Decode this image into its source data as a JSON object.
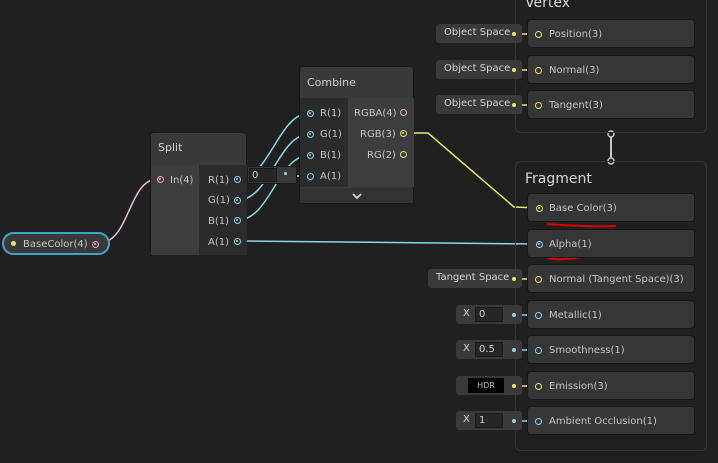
{
  "graph": {
    "property_node": {
      "label": "BaseColor(4)"
    },
    "split_node": {
      "title": "Split",
      "input": "In(4)",
      "outputs": [
        "R(1)",
        "G(1)",
        "B(1)",
        "A(1)"
      ]
    },
    "combine_node": {
      "title": "Combine",
      "inputs": [
        "R(1)",
        "G(1)",
        "B(1)",
        "A(1)"
      ],
      "outputs": [
        "RGBA(4)",
        "RGB(3)",
        "RG(2)"
      ],
      "a_default": "0"
    },
    "vertex": {
      "title": "Vertex",
      "blocks": [
        {
          "label": "Position(3)",
          "input": "Object Space"
        },
        {
          "label": "Normal(3)",
          "input": "Object Space"
        },
        {
          "label": "Tangent(3)",
          "input": "Object Space"
        }
      ]
    },
    "fragment": {
      "title": "Fragment",
      "blocks": [
        {
          "label": "Base Color(3)"
        },
        {
          "label": "Alpha(1)"
        },
        {
          "label": "Normal (Tangent Space)(3)",
          "input": "Tangent Space"
        },
        {
          "label": "Metallic(1)",
          "axis": "X",
          "value": "0"
        },
        {
          "label": "Smoothness(1)",
          "axis": "X",
          "value": "0.5"
        },
        {
          "label": "Emission(3)",
          "value": "HDR"
        },
        {
          "label": "Ambient Occlusion(1)",
          "axis": "X",
          "value": "1"
        }
      ]
    }
  },
  "colors": {
    "background": "#202020",
    "node": "#393939",
    "wire_color": "#e9e56f",
    "wire_vector1": "#8cd6e8",
    "wire_vector4": "#f0a6d6",
    "annotation": "#e00000",
    "selection": "#44a3c8"
  },
  "icons": {
    "expand": "chevron-down-icon"
  }
}
